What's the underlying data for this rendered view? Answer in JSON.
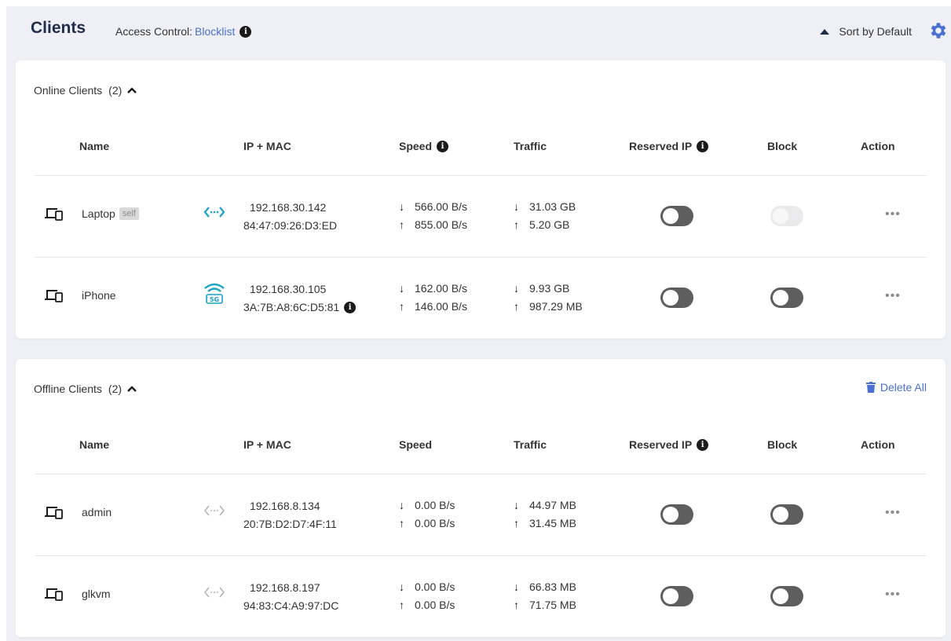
{
  "header": {
    "title": "Clients",
    "access_label": "Access Control:",
    "access_value": "Blocklist",
    "sort_label": "Sort by Default"
  },
  "online": {
    "title": "Online Clients",
    "count": "(2)",
    "columns": [
      "Name",
      "IP + MAC",
      "Speed",
      "Traffic",
      "Reserved IP",
      "Block",
      "Action"
    ],
    "rows": [
      {
        "name": "Laptop",
        "badge": "self",
        "connection": "ethernet-icon",
        "ip": "192.168.30.142",
        "mac": "84:47:09:26:D3:ED",
        "speed_down": "566.00 B/s",
        "speed_up": "855.00 B/s",
        "traffic_down": "31.03 GB",
        "traffic_up": "5.20 GB",
        "reserved_ip": false,
        "block": false,
        "block_disabled": true,
        "action": "•••"
      },
      {
        "name": "iPhone",
        "connection": "wifi-5g-icon",
        "ip": "192.168.30.105",
        "mac": "3A:7B:A8:6C:D5:81",
        "speed_down": "162.00 B/s",
        "speed_up": "146.00 B/s",
        "traffic_down": "9.93 GB",
        "traffic_up": "987.29 MB",
        "reserved_ip": false,
        "block": false,
        "action": "•••"
      }
    ]
  },
  "offline": {
    "title": "Offline Clients",
    "count": "(2)",
    "delete_all": "Delete All",
    "columns": [
      "Name",
      "IP + MAC",
      "Speed",
      "Traffic",
      "Reserved IP",
      "Block",
      "Action"
    ],
    "rows": [
      {
        "name": "admin",
        "connection": "ethernet-icon",
        "ip": "192.168.8.134",
        "mac": "20:7B:D2:D7:4F:11",
        "speed_down": "0.00 B/s",
        "speed_up": "0.00 B/s",
        "traffic_down": "44.97 MB",
        "traffic_up": "31.45 MB",
        "reserved_ip": false,
        "block": false,
        "action": "•••"
      },
      {
        "name": "glkvm",
        "connection": "ethernet-icon",
        "ip": "192.168.8.197",
        "mac": "94:83:C4:A9:97:DC",
        "speed_down": "0.00 B/s",
        "speed_up": "0.00 B/s",
        "traffic_down": "66.83 MB",
        "traffic_up": "71.75 MB",
        "reserved_ip": false,
        "block": false,
        "action": "•••"
      }
    ]
  },
  "colors": {
    "accent": "#4a70d6",
    "ethernet_online": "#1aa3c8",
    "ethernet_offline": "#b5b5b5",
    "toggle_off": "#5e5e5e"
  }
}
